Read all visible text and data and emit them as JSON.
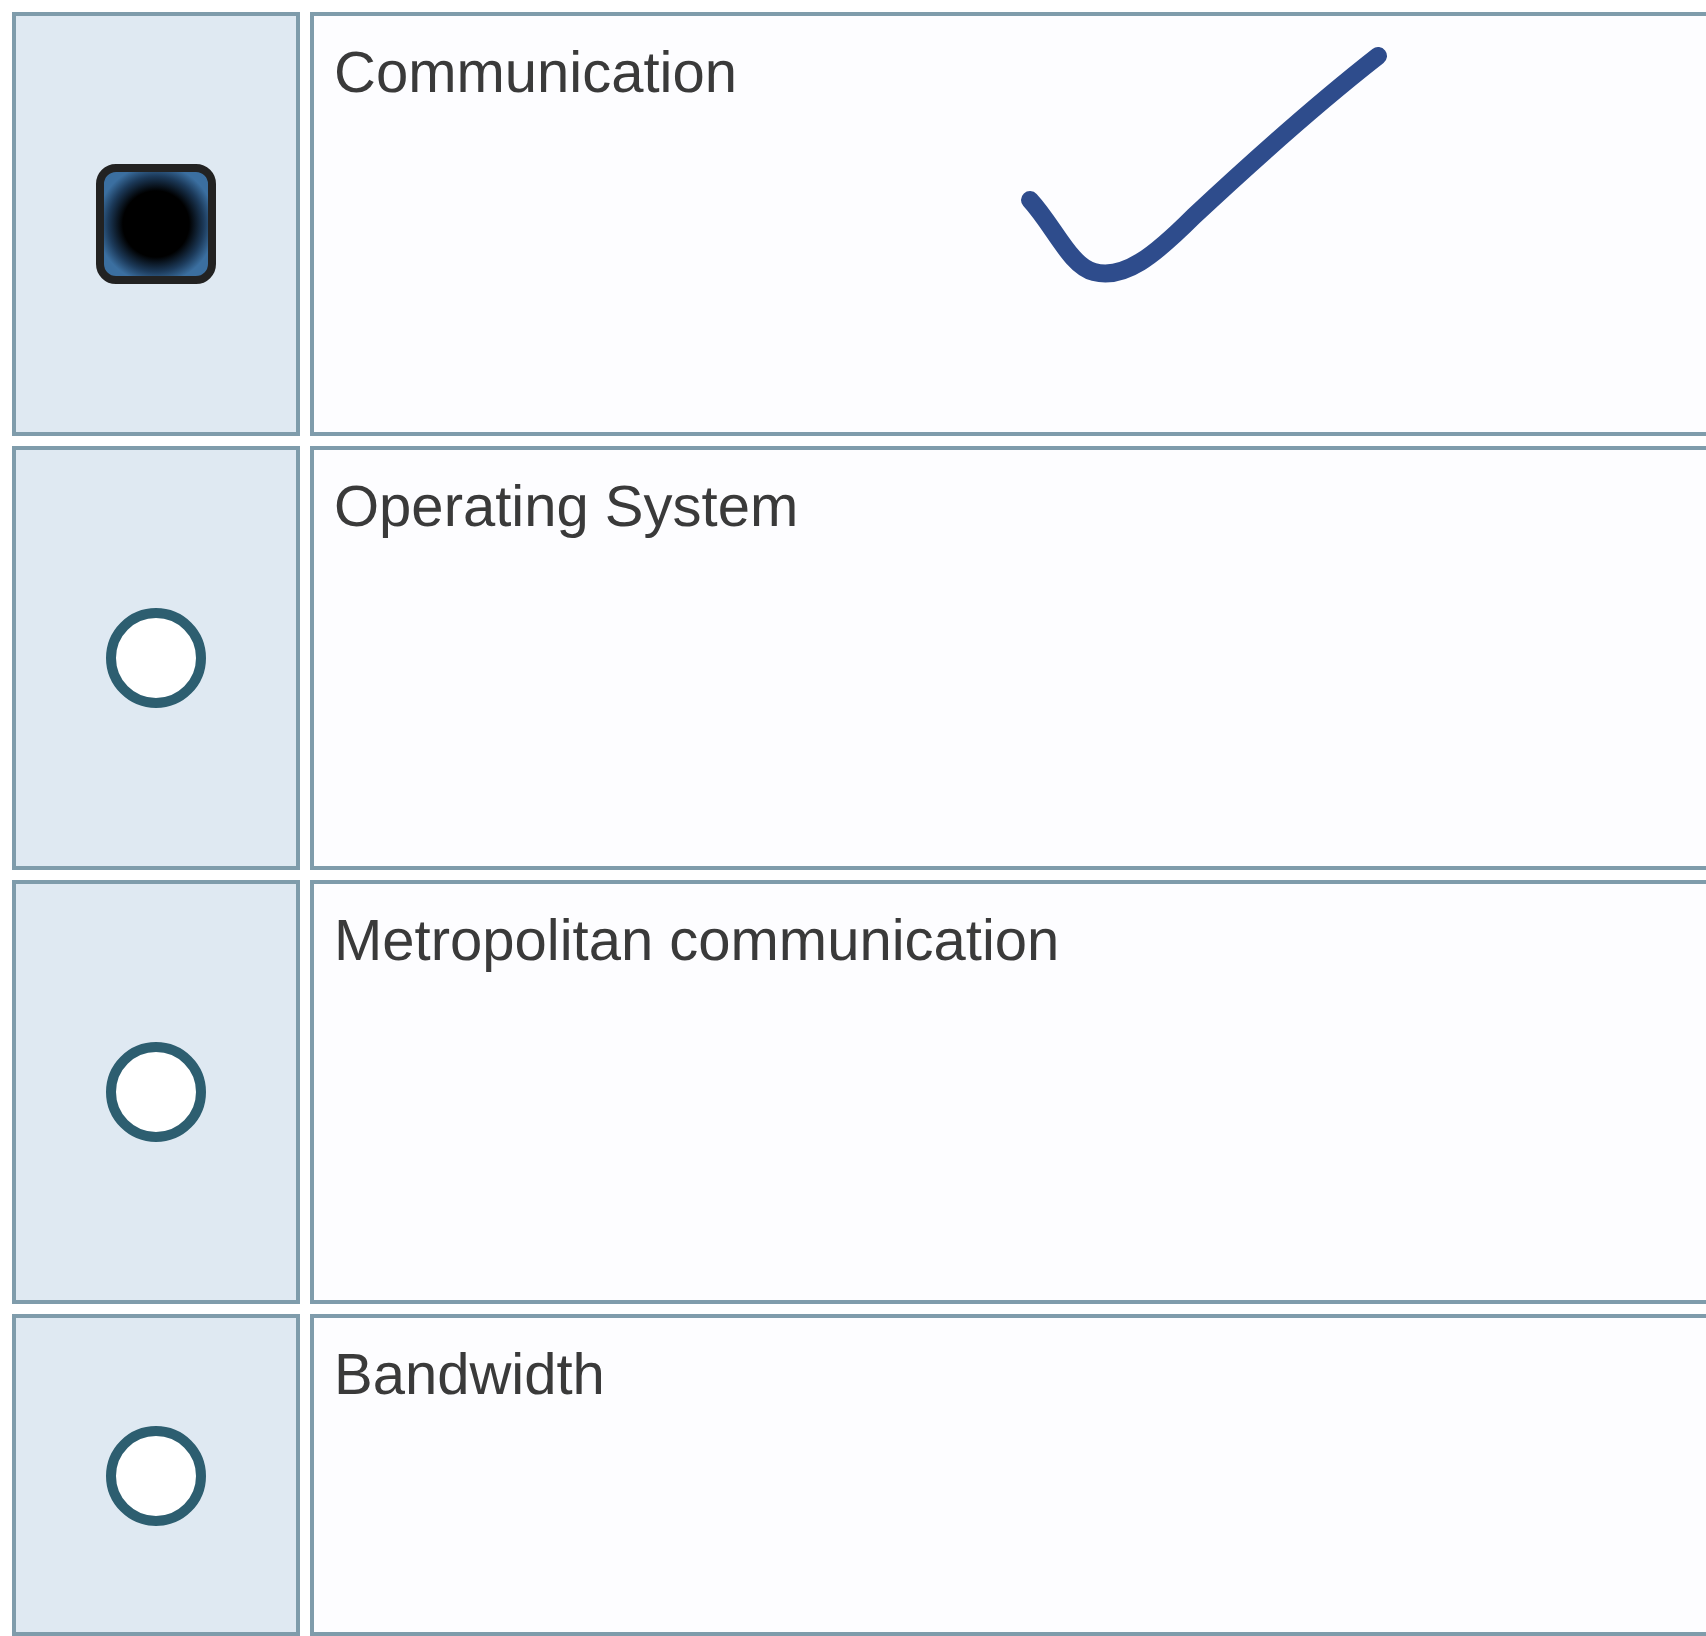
{
  "options": [
    {
      "label": "Communication",
      "selected": true,
      "handwritten_check": true
    },
    {
      "label": "Operating System",
      "selected": false,
      "handwritten_check": false
    },
    {
      "label": "Metropolitan communication",
      "selected": false,
      "handwritten_check": false
    },
    {
      "label": "Bandwidth",
      "selected": false,
      "handwritten_check": false
    }
  ]
}
